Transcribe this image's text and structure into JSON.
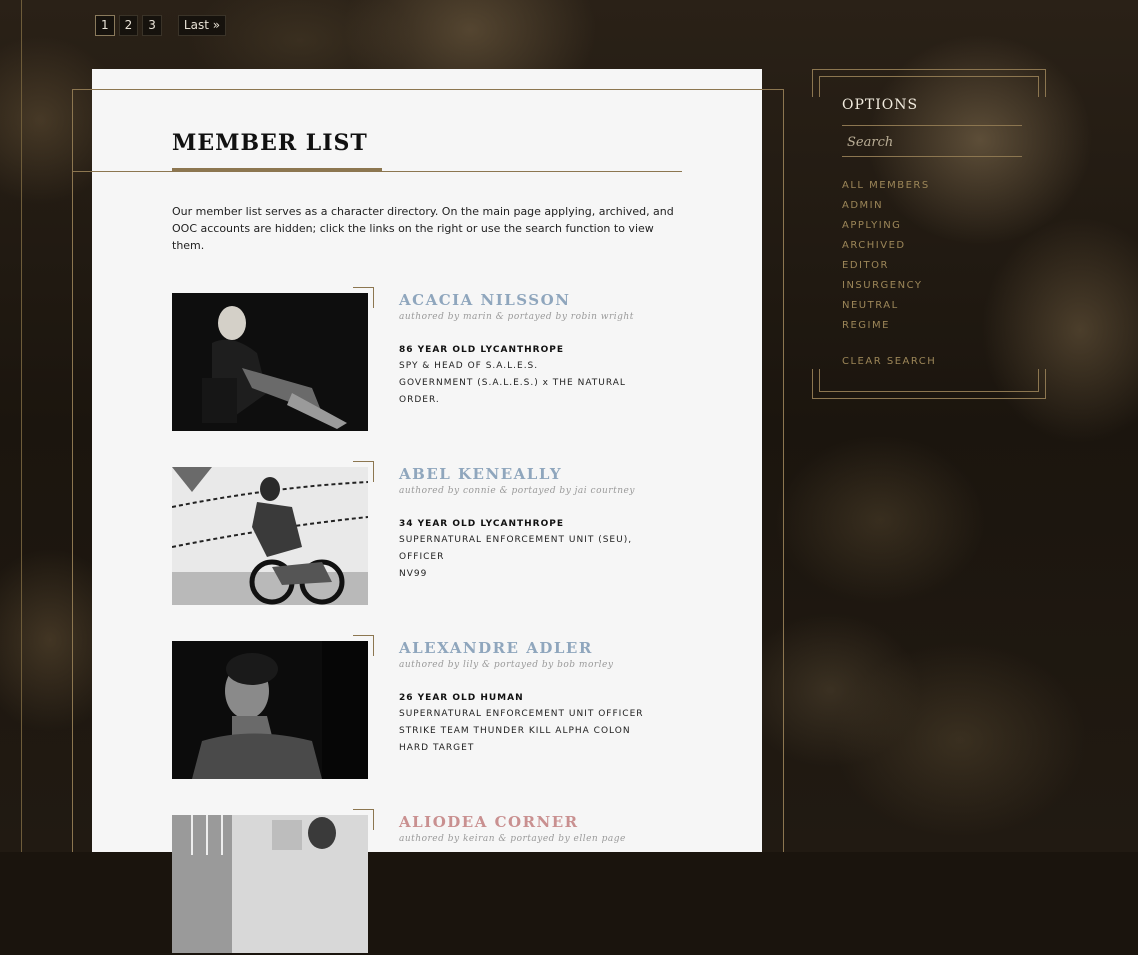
{
  "pagination": {
    "pages": [
      "1",
      "2",
      "3"
    ],
    "last_label": "Last »"
  },
  "main": {
    "title": "MEMBER LIST",
    "intro": "Our member list serves as a character directory. On the main page applying, archived, and OOC accounts are hidden; click the links on the right or use the search function to view them."
  },
  "members": [
    {
      "name": "ACACIA NILSSON",
      "credit": "authored by marin & portayed by robin wright",
      "age": "86 YEAR OLD LYCANTHROPE",
      "lines": [
        "SPY & HEAD OF S.A.L.E.S.",
        "GOVERNMENT (S.A.L.E.S.) x THE NATURAL",
        "ORDER."
      ]
    },
    {
      "name": "ABEL KENEALLY",
      "credit": "authored by connie & portayed by jai courtney",
      "age": "34 YEAR OLD LYCANTHROPE",
      "lines": [
        "SUPERNATURAL ENFORCEMENT UNIT (SEU),",
        "OFFICER",
        "NV99"
      ]
    },
    {
      "name": "ALEXANDRE ADLER",
      "credit": "authored by lily & portayed by bob morley",
      "age": "26 YEAR OLD HUMAN",
      "lines": [
        "SUPERNATURAL ENFORCEMENT UNIT OFFICER",
        "STRIKE TEAM THUNDER KILL ALPHA COLON",
        "HARD TARGET"
      ]
    },
    {
      "name": "ALIODEA CORNER",
      "credit": "authored by keiran & portayed by ellen page"
    }
  ],
  "options": {
    "title": "OPTIONS",
    "search_placeholder": "Search",
    "links": [
      "ALL MEMBERS",
      "ADMIN",
      "APPLYING",
      "ARCHIVED",
      "EDITOR",
      "INSURGENCY",
      "NEUTRAL",
      "REGIME"
    ],
    "clear_label": "CLEAR SEARCH"
  },
  "colors": {
    "gold": "#8c7650",
    "name_blue": "#8fa6bd",
    "name_pink": "#c99090",
    "panel": "#f6f6f6"
  }
}
